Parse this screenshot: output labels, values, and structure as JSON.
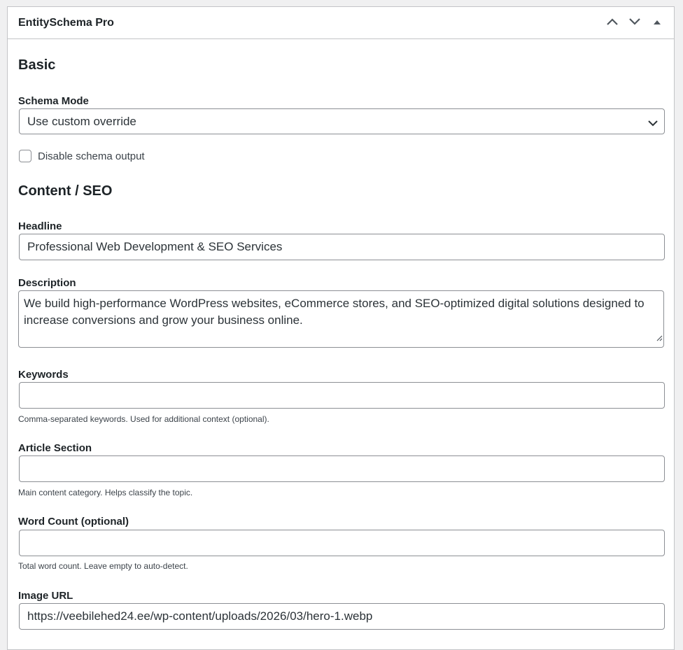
{
  "metabox": {
    "title": "EntitySchema Pro",
    "actions": [
      {
        "name": "move-up-icon"
      },
      {
        "name": "move-down-icon"
      },
      {
        "name": "toggle-panel-icon"
      }
    ]
  },
  "basic": {
    "heading": "Basic",
    "schema_mode": {
      "label": "Schema Mode",
      "value": "Use custom override"
    },
    "disable_output": {
      "label": "Disable schema output",
      "checked": false
    }
  },
  "content": {
    "heading": "Content / SEO",
    "headline": {
      "label": "Headline",
      "value": "Professional Web Development & SEO Services"
    },
    "description": {
      "label": "Description",
      "value": "We build high-performance WordPress websites, eCommerce stores, and SEO-optimized digital solutions designed to increase conversions and grow your business online."
    },
    "keywords": {
      "label": "Keywords",
      "value": "",
      "help": "Comma-separated keywords. Used for additional context (optional)."
    },
    "article_section": {
      "label": "Article Section",
      "value": "",
      "help": "Main content category. Helps classify the topic."
    },
    "word_count": {
      "label": "Word Count (optional)",
      "value": "",
      "help": "Total word count. Leave empty to auto-detect."
    },
    "image_url": {
      "label": "Image URL",
      "value": "https://veebilehed24.ee/wp-content/uploads/2026/03/hero-1.webp"
    }
  },
  "colors": {
    "border": "#8c8f94",
    "text": "#1d2327",
    "panel_border": "#c3c4c7",
    "background": "#f0f0f1"
  }
}
